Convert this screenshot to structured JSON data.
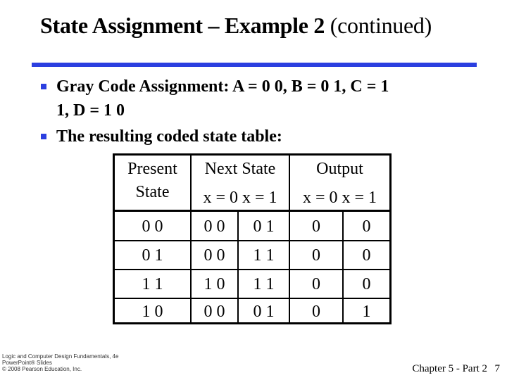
{
  "slide": {
    "title_bold": "State Assignment – Example 2",
    "title_normal": "(continued)",
    "accent_color": "#2b3fe0",
    "bullets": [
      {
        "line1": "Gray Code Assignment: A = 0 0, B = 0 1, C = 1",
        "line2": "1, D = 1 0"
      },
      {
        "line1": "The resulting coded state table:"
      }
    ],
    "table": {
      "headers": {
        "present_line1": "Present",
        "present_line2": "State",
        "next_state": "Next State",
        "next_sub": "x = 0 x = 1",
        "output": "Output",
        "output_sub": "x = 0 x = 1"
      },
      "rows": [
        {
          "present": "0 0",
          "next_x0": "0 0",
          "next_x1": "0 1",
          "out_x0": "0",
          "out_x1": "0"
        },
        {
          "present": "0 1",
          "next_x0": "0 0",
          "next_x1": "1 1",
          "out_x0": "0",
          "out_x1": "0"
        },
        {
          "present": "1 1",
          "next_x0": "1 0",
          "next_x1": "1 1",
          "out_x0": "0",
          "out_x1": "0"
        },
        {
          "present": "1 0",
          "next_x0": "0 0",
          "next_x1": "0 1",
          "out_x0": "0",
          "out_x1": "1"
        }
      ]
    },
    "footer": {
      "book_line1": "Logic and Computer Design Fundamentals, 4e",
      "book_line2": "PowerPoint® Slides",
      "book_line3": "© 2008 Pearson Education, Inc.",
      "chapter": "Chapter 5 - Part 2",
      "page": "7"
    }
  }
}
